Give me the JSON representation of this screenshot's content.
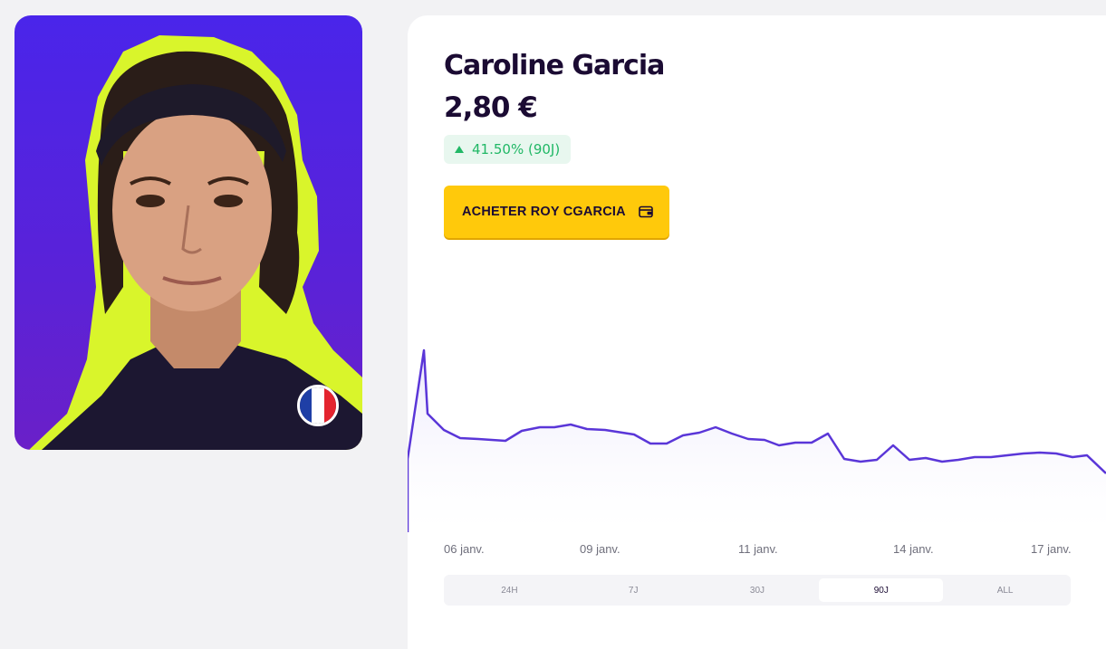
{
  "player": {
    "name": "Caroline Garcia",
    "price": "2,80 €",
    "change": "41.50% (90J)",
    "buy_label": "ACHETER ROY CGARCIA",
    "flag": {
      "country": "France",
      "colors": [
        "#1f3fa6",
        "#ffffff",
        "#e4242e"
      ]
    }
  },
  "colors": {
    "accent": "#ffc90b",
    "card_background": "#4a25ea",
    "outline": "#d9f52b",
    "positive": "#21b866",
    "line": "#5a36d8"
  },
  "icons": {
    "wallet": "wallet-icon",
    "change_arrow": "triangle-up-icon"
  },
  "chart": {
    "x_labels": [
      "06 janv.",
      "09 janv.",
      "11 janv.",
      "14 janv.",
      "17 janv."
    ],
    "ranges": [
      "24H",
      "7J",
      "30J",
      "90J",
      "ALL"
    ],
    "selected_range": "90J"
  }
}
